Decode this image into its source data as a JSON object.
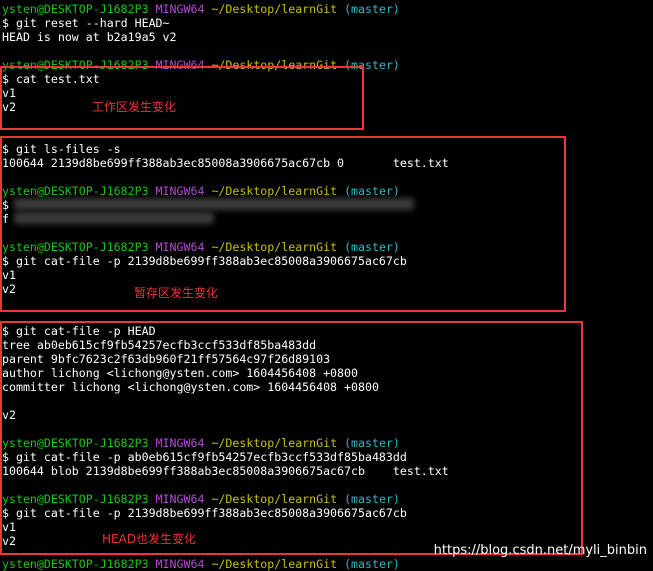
{
  "prompt": {
    "user": "ysten@DESKTOP-J1682P3",
    "shell": "MINGW64",
    "path_desktop": "~/Desktop/learnGit",
    "branch": "(master)"
  },
  "lines": {
    "l01_user": "ysten@DESKTOP-J1682P3",
    "l01_shell": "MINGW64",
    "l01_path": "~/Desktop/learnGit",
    "l01_branch": "(master)",
    "l02": "$ git reset --hard HEAD~",
    "l03": "HEAD is now at b2a19a5 v2",
    "l05_user": "ysten@DESKTOP-J1682P3",
    "l05_shell": "MINGW64",
    "l05_path": "~/Desktop/learnGit",
    "l05_branch": "(master)",
    "l06": "$ cat test.txt",
    "l07": "v1",
    "l08": "v2",
    "l10": "$ git ls-files -s",
    "l11": "100644 2139d8be699ff388ab3ec85008a3906675ac67cb 0       test.txt",
    "l13_user": "ysten@DESKTOP-J1682P3",
    "l13_shell": "MINGW64",
    "l13_path": "~/Desktop/learnGit",
    "l13_branch": "(master)",
    "l14": "$",
    "l15": "f",
    "l17_user": "ysten@DESKTOP-J1682P3",
    "l17_shell": "MINGW64",
    "l17_path": "~/Desktop/learnGit",
    "l17_branch": "(master)",
    "l18": "$ git cat-file -p 2139d8be699ff388ab3ec85008a3906675ac67cb",
    "l19": "v1",
    "l20": "v2",
    "l22": "$ git cat-file -p HEAD",
    "l23": "tree ab0eb615cf9fb54257ecfb3ccf533df85ba483dd",
    "l24": "parent 9bfc7623c2f63db960f21ff57564c97f26d89103",
    "l25": "author lichong <lichong@ysten.com> 1604456408 +0800",
    "l26": "committer lichong <lichong@ysten.com> 1604456408 +0800",
    "l28": "v2",
    "l30_user": "ysten@DESKTOP-J1682P3",
    "l30_shell": "MINGW64",
    "l30_path": "~/Desktop/learnGit",
    "l30_branch": "(master)",
    "l31": "$ git cat-file -p ab0eb615cf9fb54257ecfb3ccf533df85ba483dd",
    "l32": "100644 blob 2139d8be699ff388ab3ec85008a3906675ac67cb    test.txt",
    "l34_user": "ysten@DESKTOP-J1682P3",
    "l34_shell": "MINGW64",
    "l34_path": "~/Desktop/learnGit",
    "l34_branch": "(master)",
    "l35": "$ git cat-file -p 2139d8be699ff388ab3ec85008a3906675ac67cb",
    "l36": "v1",
    "l37": "v2",
    "l38_user": "ysten@DESKTOP-J1682P3",
    "l38_shell": "MINGW64",
    "l38_path": "~/Desktop/learnGit",
    "l38_branch": "(master)"
  },
  "annotations": {
    "working_dir": "工作区发生变化",
    "staging": "暂存区发生变化",
    "head": "HEAD也发生变化"
  },
  "watermark": "https://blog.csdn.net/myli_binbin",
  "colors": {
    "background": "#000000",
    "prompt_user": "#12c912",
    "prompt_shell": "#b24bd1",
    "prompt_path": "#c8c000",
    "prompt_branch": "#2bb8c9",
    "highlight_box": "#e8363a"
  }
}
